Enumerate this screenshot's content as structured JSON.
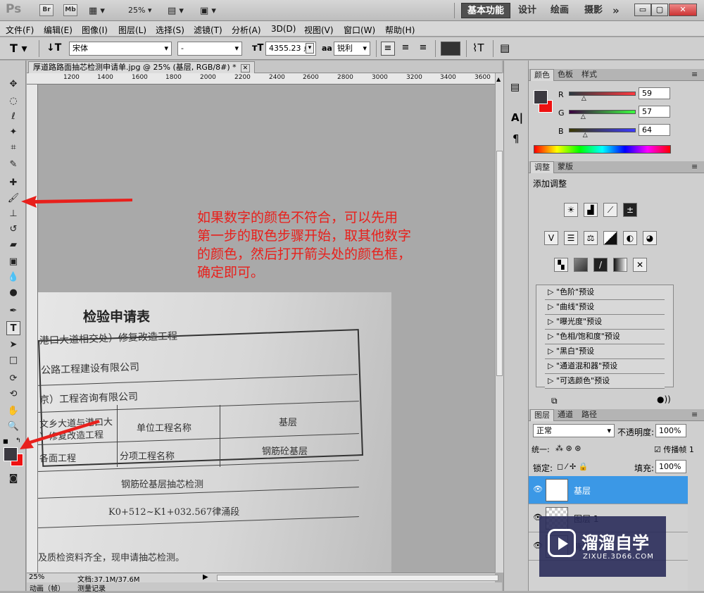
{
  "app": {
    "logo": "Ps",
    "br": "Br",
    "mb": "Mb",
    "zoom": "25%"
  },
  "workspaces": [
    "基本功能",
    "设计",
    "绘画",
    "摄影",
    "»"
  ],
  "menu": [
    "文件(F)",
    "编辑(E)",
    "图像(I)",
    "图层(L)",
    "选择(S)",
    "滤镜(T)",
    "分析(A)",
    "3D(D)",
    "视图(V)",
    "窗口(W)",
    "帮助(H)"
  ],
  "options": {
    "font_family": "宋体",
    "font_style": "-",
    "font_size": "4355.23 点",
    "aa_label": "aa",
    "antialias": "锐利",
    "text_color": "#333333"
  },
  "document": {
    "tab_title": "厚道路路面抽芯检测申请单.jpg @ 25% (基层, RGB/8#) *",
    "ruler_labels": [
      "1200",
      "1400",
      "1600",
      "1800",
      "2000",
      "2200",
      "2400",
      "2600",
      "2800",
      "3000",
      "3200",
      "3400",
      "3600"
    ],
    "annotation_lines": [
      "如果数字的颜色不符合，可以先用",
      "第一步的取色步骤开始，取其他数字",
      "的颜色，然后打开箭头处的颜色框，",
      "确定即可。"
    ],
    "photo": {
      "title": "检验申请表",
      "line1": "港口大道相交处）修复改造工程",
      "line2": "公路工程建设有限公司",
      "line3": "京）工程咨询有限公司",
      "cell_left_top": "文乡大道与港口大",
      "cell_left_top2": "）修复改造工程",
      "cell_unit_label": "单位工程名称",
      "cell_unit_value": "基层",
      "cell_left_mid": "各面工程",
      "cell_sub_label": "分项工程名称",
      "cell_sub_value": "钢筋砼基层",
      "row_test": "钢筋砼基层抽芯检测",
      "row_range": "K0+512~K1+032.567律涌段",
      "bottom_text": "及质检资料齐全，现申请抽芯检测。"
    }
  },
  "status": {
    "zoom": "25%",
    "doc_info": "文档:37.1M/37.6M"
  },
  "bottom_tabs": [
    "动画（帧）",
    "测量记录"
  ],
  "color_panel": {
    "tabs": [
      "颜色",
      "色板",
      "样式"
    ],
    "r_label": "R",
    "g_label": "G",
    "b_label": "B",
    "r": "59",
    "g": "57",
    "b": "64",
    "r_fraction": 0.23,
    "g_fraction": 0.22,
    "b_fraction": 0.25,
    "fg_color": "#3b3940",
    "bg_color": "#ee1111"
  },
  "adjust_panel": {
    "tabs": [
      "调整",
      "蒙版"
    ],
    "heading": "添加调整",
    "presets": [
      "\"色阶\"预设",
      "\"曲线\"预设",
      "\"曝光度\"预设",
      "\"色相/饱和度\"预设",
      "\"黑白\"预设",
      "\"通道混和器\"预设",
      "\"可选颜色\"预设"
    ]
  },
  "layers_panel": {
    "tabs": [
      "图层",
      "通道",
      "路径"
    ],
    "blend_mode": "正常",
    "opacity_label": "不透明度:",
    "opacity": "100%",
    "unify_label": "统一:",
    "propagate_label": "传播帧 1",
    "lock_label": "锁定:",
    "fill_label": "填充:",
    "fill": "100%",
    "layers": [
      {
        "name": "基层",
        "thumb": "T",
        "selected": true
      },
      {
        "name": "图层 1",
        "thumb": "",
        "selected": false
      },
      {
        "name": "背景",
        "thumb": "",
        "selected": false
      }
    ]
  },
  "watermark": {
    "name": "溜溜自学",
    "url": "ZIXUE.3D66.COM"
  }
}
